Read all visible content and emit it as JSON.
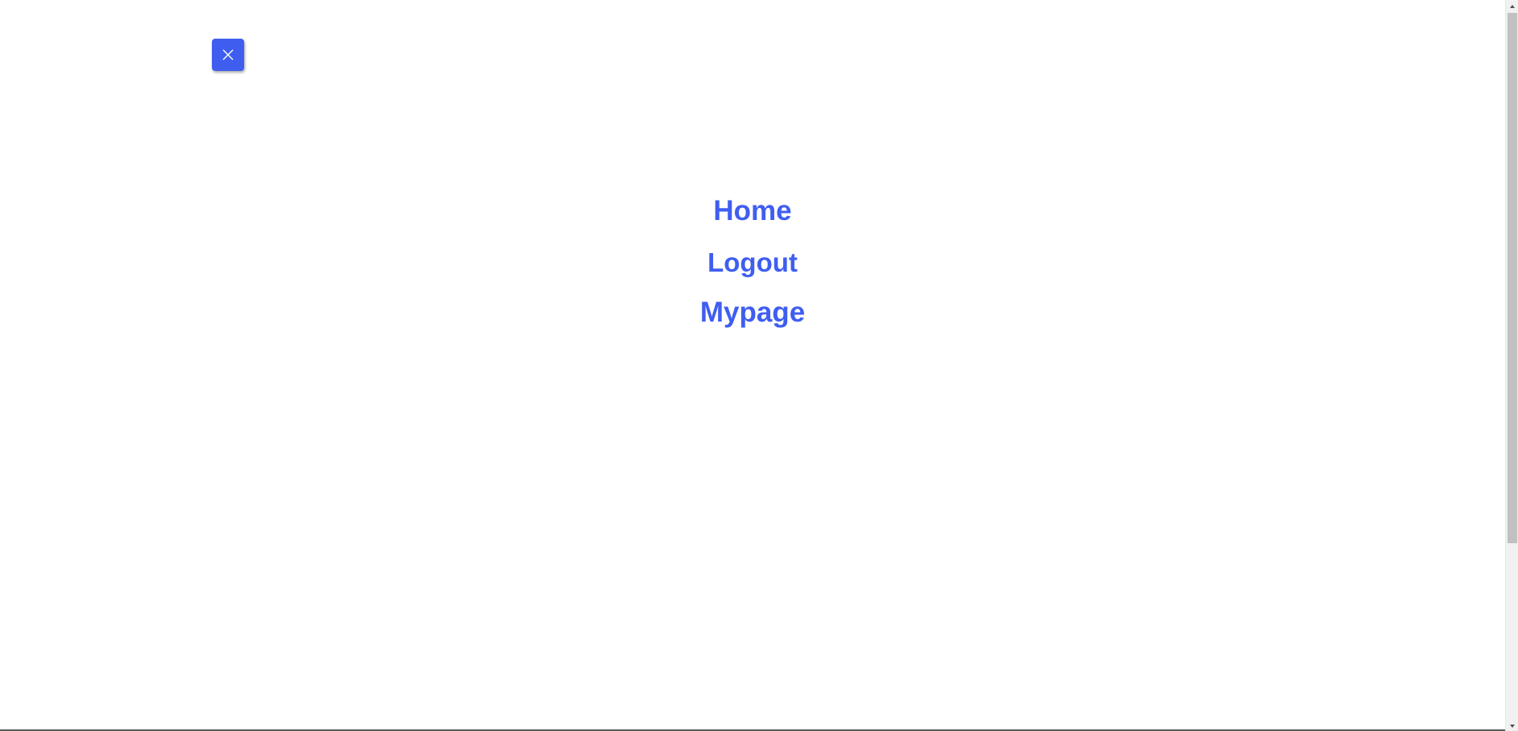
{
  "close_button": {
    "icon": "close-icon",
    "color": "#3f5ef0"
  },
  "menu": {
    "items": [
      {
        "label": "Home"
      },
      {
        "label": "Logout"
      },
      {
        "label": "Mypage"
      }
    ],
    "link_color": "#3f5ef0"
  },
  "scrollbar": {
    "up_icon": "scroll-up-arrow-icon",
    "down_icon": "scroll-down-arrow-icon"
  }
}
